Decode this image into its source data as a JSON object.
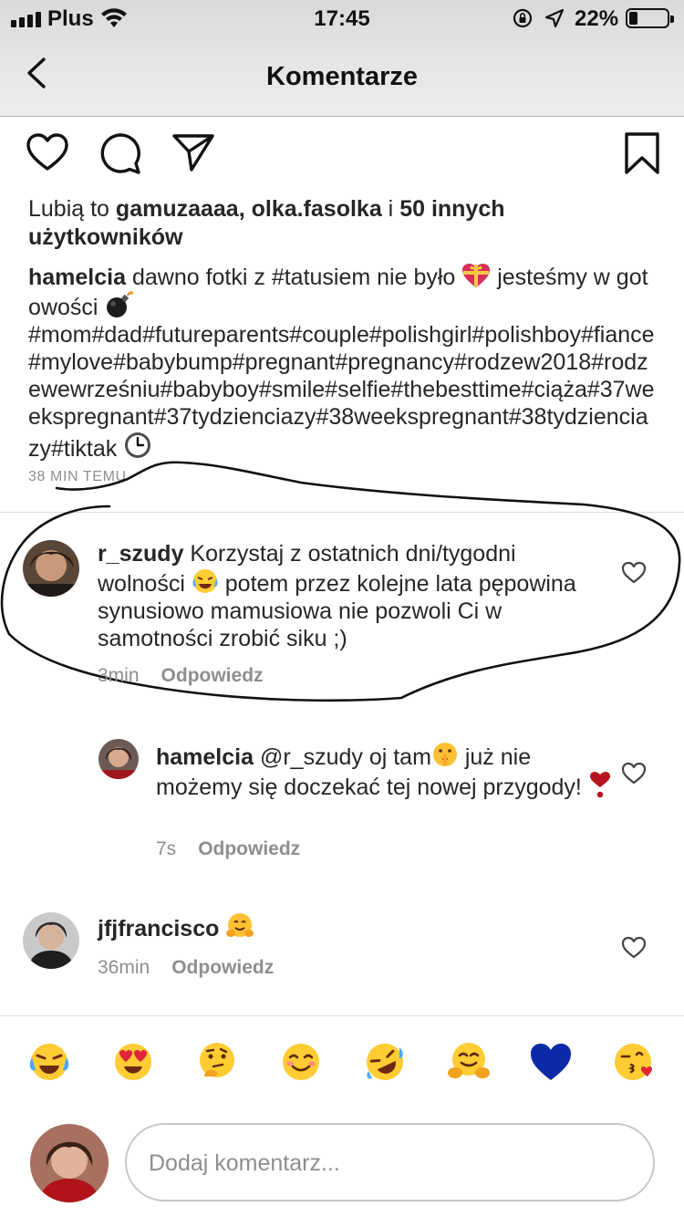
{
  "status_bar": {
    "carrier": "Plus",
    "time": "17:45",
    "battery_percent": "22%",
    "battery_level": 0.22
  },
  "nav": {
    "title": "Komentarze",
    "back_icon": "chevron-left-icon"
  },
  "actions": {
    "icons": [
      "heart-icon",
      "comment-icon",
      "send-icon",
      "bookmark-icon"
    ]
  },
  "likes": {
    "prefix": "Lubią to ",
    "users": "gamuzaaaa, olka.fasolka",
    "joiner": " i ",
    "others": "50 innych użytkowników"
  },
  "caption": {
    "username": "hamelcia",
    "text_part1": " dawno fotki z #tatusiem nie było ",
    "text_part2": " jesteśmy w gotowości ",
    "hashtags": "#mom#dad#futureparents#couple#polishgirl#polishboy#fiance#mylove#babybump#pregnant#pregnancy#rodzew2018#rodzewewrześniu#babyboy#smile#selfie#thebesttime#ciąża#37weekspregnant#37tydzienciazy#38weekspregnant#38tydzienciazy#tiktak ",
    "time": "38 MIN TEMU"
  },
  "comments": [
    {
      "username": "r_szudy",
      "text_part1": " Korzystaj z ostatnich dni/tygodni wolności ",
      "text_part2": " potem przez kolejne lata pępowina synusiowo mamusiowa nie pozwoli Ci w samotności zrobić siku ;)",
      "time": "3min",
      "reply_label": "Odpowiedz"
    },
    {
      "username": "hamelcia",
      "text_part1": " @r_szudy oj tam",
      "text_part2": " już nie możemy się doczekać tej nowej przygody! ",
      "time": "7s",
      "reply_label": "Odpowiedz"
    },
    {
      "username": "jfjfrancisco",
      "text_part1": " ",
      "time": "36min",
      "reply_label": "Odpowiedz"
    }
  ],
  "emoji_bar": [
    "tears-of-joy-emoji",
    "heart-eyes-emoji",
    "thinking-emoji",
    "smiling-blush-emoji",
    "rofl-emoji",
    "hugging-emoji",
    "blue-heart-emoji",
    "kissing-heart-emoji"
  ],
  "composer": {
    "placeholder": "Dodaj komentarz...",
    "value": ""
  },
  "colors": {
    "text": "#262626",
    "muted": "#8e8e8e",
    "separator": "#dbdbdb",
    "blue_heart": "#0a2aa8"
  }
}
